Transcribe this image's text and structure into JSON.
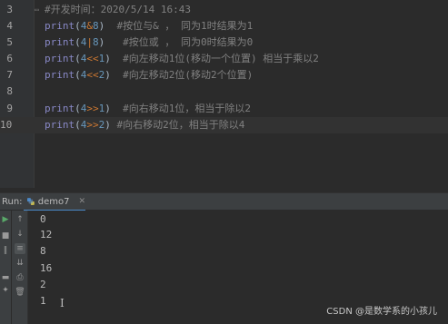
{
  "editor": {
    "lines": [
      {
        "num": "3",
        "code": [
          {
            "t": "#开发时间：2020/5/14 16:43",
            "c": "c-cm"
          }
        ]
      },
      {
        "num": "4",
        "code": [
          {
            "t": "print",
            "c": "c-fn"
          },
          {
            "t": "(",
            "c": ""
          },
          {
            "t": "4",
            "c": "c-num"
          },
          {
            "t": "&",
            "c": "c-op"
          },
          {
            "t": "8",
            "c": "c-num"
          },
          {
            "t": ")  ",
            "c": ""
          },
          {
            "t": "#按位与& ， 同为1时结果为1",
            "c": "c-cm"
          }
        ]
      },
      {
        "num": "5",
        "code": [
          {
            "t": "print",
            "c": "c-fn"
          },
          {
            "t": "(",
            "c": ""
          },
          {
            "t": "4",
            "c": "c-num"
          },
          {
            "t": "|",
            "c": "c-op"
          },
          {
            "t": "8",
            "c": "c-num"
          },
          {
            "t": ")   ",
            "c": ""
          },
          {
            "t": "#按位或 ， 同为0时结果为0",
            "c": "c-cm"
          }
        ]
      },
      {
        "num": "6",
        "code": [
          {
            "t": "print",
            "c": "c-fn"
          },
          {
            "t": "(",
            "c": ""
          },
          {
            "t": "4",
            "c": "c-num"
          },
          {
            "t": "<<",
            "c": "c-op"
          },
          {
            "t": "1",
            "c": "c-num"
          },
          {
            "t": ")  ",
            "c": ""
          },
          {
            "t": "#向左移动1位(移动一个位置) 相当于乘以2",
            "c": "c-cm"
          }
        ]
      },
      {
        "num": "7",
        "code": [
          {
            "t": "print",
            "c": "c-fn"
          },
          {
            "t": "(",
            "c": ""
          },
          {
            "t": "4",
            "c": "c-num"
          },
          {
            "t": "<<",
            "c": "c-op"
          },
          {
            "t": "2",
            "c": "c-num"
          },
          {
            "t": ")  ",
            "c": ""
          },
          {
            "t": "#向左移动2位(移动2个位置)",
            "c": "c-cm"
          }
        ]
      },
      {
        "num": "8",
        "code": []
      },
      {
        "num": "9",
        "code": [
          {
            "t": "print",
            "c": "c-fn"
          },
          {
            "t": "(",
            "c": ""
          },
          {
            "t": "4",
            "c": "c-num"
          },
          {
            "t": ">>",
            "c": "c-op"
          },
          {
            "t": "1",
            "c": "c-num"
          },
          {
            "t": ")  ",
            "c": ""
          },
          {
            "t": "#向右移动1位，相当于除以2",
            "c": "c-cm"
          }
        ]
      },
      {
        "num": "10",
        "code": [
          {
            "t": "print",
            "c": "c-fn"
          },
          {
            "t": "(",
            "c": ""
          },
          {
            "t": "4",
            "c": "c-num"
          },
          {
            "t": ">>",
            "c": "c-op"
          },
          {
            "t": "2",
            "c": "c-num"
          },
          {
            "t": ") ",
            "c": ""
          },
          {
            "t": "#向右移动2位，相当于除以4",
            "c": "c-cm"
          }
        ]
      }
    ]
  },
  "run_panel": {
    "label": "Run:",
    "tab_label": "demo7",
    "output": [
      "0",
      "12",
      "8",
      "16",
      "2",
      "1"
    ]
  },
  "watermark": "CSDN @是数学系的小孩儿"
}
